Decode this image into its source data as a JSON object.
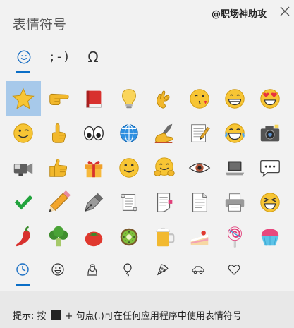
{
  "window": {
    "title": "表情符号",
    "watermark": "@职场神助攻",
    "close_icon": "close-icon"
  },
  "top_tabs": [
    {
      "name": "smiley-face-icon",
      "label": ""
    },
    {
      "name": "kaomoji-tab",
      "label": ";-)"
    },
    {
      "name": "symbols-tab",
      "label": "Ω"
    }
  ],
  "emoji_grid": [
    [
      "star",
      "backhand-index-right",
      "red-book",
      "light-bulb",
      "ok-hand",
      "face-blowing-kiss",
      "grinning-face",
      "heart-eyes-face"
    ],
    [
      "winking-face",
      "index-pointing-up",
      "eyes",
      "globe-with-meridians",
      "writing-hand",
      "memo",
      "face-with-tears-of-joy",
      "camera-with-flash"
    ],
    [
      "video-camera",
      "thumbs-up",
      "wrapped-gift",
      "smiling-face",
      "hugging-face",
      "eye",
      "laptop",
      "speech-balloon"
    ],
    [
      "check-mark",
      "pencil",
      "fountain-pen-nib",
      "scroll",
      "page-with-curl",
      "page-facing-up",
      "printer",
      "squinting-face"
    ],
    [
      "hot-pepper",
      "broccoli",
      "tomato",
      "kiwi-fruit",
      "beer-mug",
      "shortcake",
      "lollipop",
      "shaved-ice"
    ]
  ],
  "bottom_tabs": [
    {
      "name": "clock-icon"
    },
    {
      "name": "smiley-outline-icon"
    },
    {
      "name": "person-outline-icon"
    },
    {
      "name": "balloon-outline-icon"
    },
    {
      "name": "pizza-outline-icon"
    },
    {
      "name": "car-outline-icon"
    },
    {
      "name": "heart-outline-icon"
    }
  ],
  "footer": {
    "hint_prefix": "提示: 按",
    "hint_suffix": "+ 句点(.)可在任何应用程序中使用表情符号"
  },
  "colors": {
    "accent": "#0a6ec7",
    "selected_cell": "#a7c9ea",
    "background": "#f2f2f2",
    "footer_bg": "#e8e8e8"
  }
}
